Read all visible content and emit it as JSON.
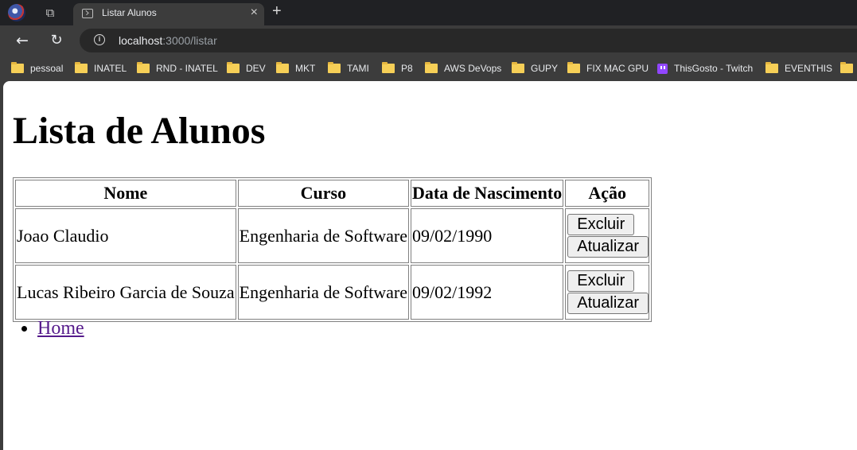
{
  "browser": {
    "tab_title": "Listar Alunos",
    "close_glyph": "×",
    "new_tab_glyph": "+",
    "back_glyph": "←",
    "reload_glyph": "↻",
    "info_glyph": "i",
    "url_host": "localhost",
    "url_path": ":3000/listar"
  },
  "bookmarks": [
    {
      "label": "pessoal",
      "icon": "folder-icon"
    },
    {
      "label": "INATEL",
      "icon": "folder-icon"
    },
    {
      "label": "RND - INATEL",
      "icon": "folder-icon"
    },
    {
      "label": "DEV",
      "icon": "folder-icon"
    },
    {
      "label": "MKT",
      "icon": "folder-icon"
    },
    {
      "label": "TAMI",
      "icon": "folder-icon"
    },
    {
      "label": "P8",
      "icon": "folder-icon"
    },
    {
      "label": "AWS DeVops",
      "icon": "folder-icon"
    },
    {
      "label": "GUPY",
      "icon": "folder-icon"
    },
    {
      "label": "FIX MAC GPU",
      "icon": "folder-icon"
    },
    {
      "label": "ThisGosto - Twitch",
      "icon": "twitch-icon"
    },
    {
      "label": "EVENTHIS",
      "icon": "folder-icon"
    }
  ],
  "page": {
    "title": "Lista de Alunos",
    "table": {
      "headers": [
        "Nome",
        "Curso",
        "Data de Nascimento",
        "Ação"
      ],
      "rows": [
        {
          "nome": "Joao Claudio",
          "curso": "Engenharia de Software",
          "nascimento": "09/02/1990",
          "excluir": "Excluir",
          "atualizar": "Atualizar"
        },
        {
          "nome": "Lucas Ribeiro Garcia de Souza",
          "curso": "Engenharia de Software",
          "nascimento": "09/02/1992",
          "excluir": "Excluir",
          "atualizar": "Atualizar"
        }
      ]
    },
    "links": [
      {
        "label": "Home"
      }
    ]
  }
}
